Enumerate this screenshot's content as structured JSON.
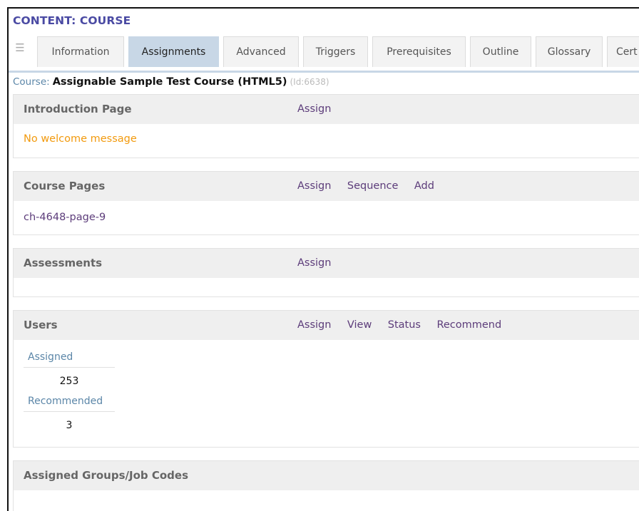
{
  "header": {
    "title": "CONTENT: COURSE"
  },
  "tabs": [
    {
      "label": "Information",
      "active": false
    },
    {
      "label": "Assignments",
      "active": true
    },
    {
      "label": "Advanced",
      "active": false
    },
    {
      "label": "Triggers",
      "active": false
    },
    {
      "label": "Prerequisites",
      "active": false
    },
    {
      "label": "Outline",
      "active": false
    },
    {
      "label": "Glossary",
      "active": false
    },
    {
      "label": "Cert",
      "active": false
    }
  ],
  "course": {
    "label": "Course:",
    "name": "Assignable Sample Test Course (HTML5)",
    "id_text": "(Id:6638)"
  },
  "sections": {
    "intro": {
      "title": "Introduction Page",
      "actions": [
        "Assign"
      ],
      "message": "No welcome message"
    },
    "pages": {
      "title": "Course Pages",
      "actions": [
        "Assign",
        "Sequence",
        "Add"
      ],
      "items": [
        "ch-4648-page-9"
      ]
    },
    "assessments": {
      "title": "Assessments",
      "actions": [
        "Assign"
      ]
    },
    "users": {
      "title": "Users",
      "actions": [
        "Assign",
        "View",
        "Status",
        "Recommend"
      ],
      "stats": [
        {
          "label": "Assigned",
          "value": "253"
        },
        {
          "label": "Recommended",
          "value": "3"
        }
      ]
    },
    "groups": {
      "title": "Assigned Groups/Job Codes"
    }
  },
  "colors": {
    "header": "#4a4aa3",
    "tab_active": "#c8d7e6",
    "link": "#5c3c7a",
    "message": "#f29a0e",
    "label_blue": "#5b86a8"
  }
}
